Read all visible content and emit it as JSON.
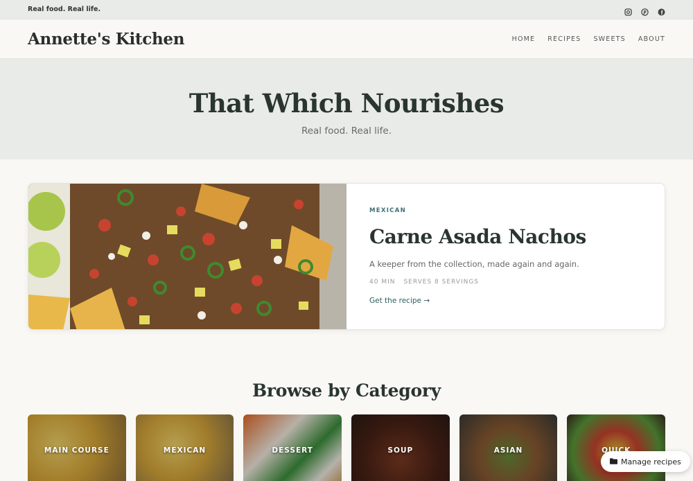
{
  "topbar": {
    "tagline": "Real food. Real life.",
    "socials": [
      {
        "icon": "instagram-icon"
      },
      {
        "icon": "pinterest-icon"
      },
      {
        "icon": "facebook-icon"
      }
    ]
  },
  "header": {
    "logo": "Annette's Kitchen",
    "nav": [
      "HOME",
      "RECIPES",
      "SWEETS",
      "ABOUT"
    ]
  },
  "hero": {
    "title": "That Which Nourishes",
    "subtitle": "Real food. Real life."
  },
  "feature": {
    "category": "MEXICAN",
    "title": "Carne Asada Nachos",
    "description": "A keeper from the collection, made again and again.",
    "time": "40 MIN",
    "serves": "SERVES 8 SERVINGS",
    "cta": "Get the recipe →"
  },
  "browse": {
    "title": "Browse by Category",
    "categories": [
      {
        "label": "MAIN COURSE"
      },
      {
        "label": "MEXICAN"
      },
      {
        "label": "DESSERT"
      },
      {
        "label": "SOUP"
      },
      {
        "label": "ASIAN"
      },
      {
        "label": "QUICK"
      }
    ]
  },
  "manage_button": {
    "label": "Manage recipes",
    "icon": "folder-icon"
  },
  "colors": {
    "accent": "#3f6f73",
    "heading": "#2a3530",
    "band": "#e8ebe7",
    "page": "#f9f8f4"
  }
}
